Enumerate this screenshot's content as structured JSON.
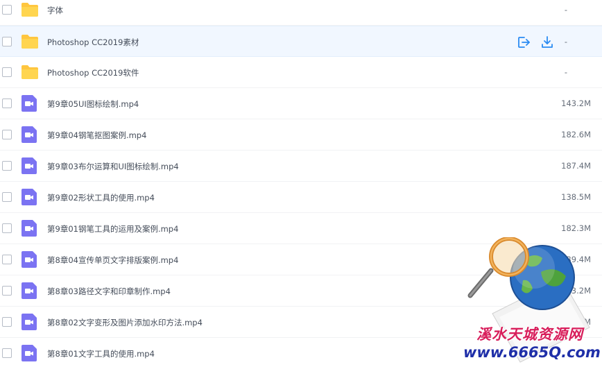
{
  "files": [
    {
      "name": "字体",
      "size": "-",
      "type": "folder"
    },
    {
      "name": "Photoshop CC2019素材",
      "size": "-",
      "type": "folder",
      "hovered": true
    },
    {
      "name": "Photoshop CC2019软件",
      "size": "-",
      "type": "folder"
    },
    {
      "name": "第9章05UI图标绘制.mp4",
      "size": "143.2M",
      "type": "video"
    },
    {
      "name": "第9章04钢笔抠图案例.mp4",
      "size": "182.6M",
      "type": "video"
    },
    {
      "name": "第9章03布尔运算和UI图标绘制.mp4",
      "size": "187.4M",
      "type": "video"
    },
    {
      "name": "第9章02形状工具的使用.mp4",
      "size": "138.5M",
      "type": "video"
    },
    {
      "name": "第9章01钢笔工具的运用及案例.mp4",
      "size": "182.3M",
      "type": "video"
    },
    {
      "name": "第8章04宣传单页文字排版案例.mp4",
      "size": "139.4M",
      "type": "video"
    },
    {
      "name": "第8章03路径文字和印章制作.mp4",
      "size": "143.2M",
      "type": "video"
    },
    {
      "name": "第8章02文字变形及图片添加水印方法.mp4",
      "size": "116.6M",
      "type": "video"
    },
    {
      "name": "第8章01文字工具的使用.mp4",
      "size": "",
      "type": "video"
    }
  ],
  "icons": {
    "folder": "folder-icon",
    "video": "video-file-icon",
    "share": "share-icon",
    "download": "download-icon"
  },
  "colors": {
    "folder": "#ffc63f",
    "video": "#7b73f2",
    "action": "#2a8bf2",
    "hover_bg": "#f1f7ff"
  },
  "watermark": {
    "cn": "溪水天城资源网",
    "url": "www.6665Q.com"
  }
}
